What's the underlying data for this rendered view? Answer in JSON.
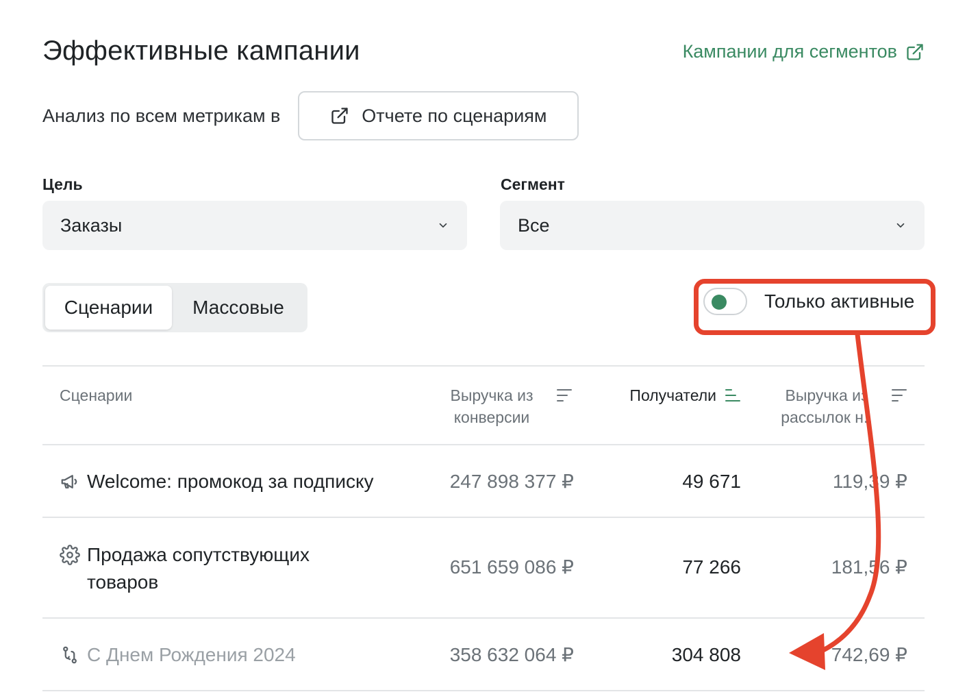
{
  "header": {
    "title": "Эффективные кампании",
    "segments_link": "Кампании для сегментов"
  },
  "analysis": {
    "text": "Анализ по всем метрикам в",
    "report_button": "Отчете по сценариям"
  },
  "filters": {
    "goal_label": "Цель",
    "goal_value": "Заказы",
    "segment_label": "Сегмент",
    "segment_value": "Все"
  },
  "tabs": [
    {
      "label": "Сценарии",
      "active": true
    },
    {
      "label": "Массовые",
      "active": false
    }
  ],
  "toggle": {
    "label": "Только активные",
    "on": true,
    "accent": "#3a8a62"
  },
  "table": {
    "columns": [
      {
        "label": "Сценарии"
      },
      {
        "label": "Выручка из конверсии",
        "sort_icon": "sort-icon"
      },
      {
        "label": "Получатели",
        "sort_icon": "sort-active-icon"
      },
      {
        "label": "Выручка из рассылок н..",
        "sort_icon": "sort-icon"
      }
    ],
    "rows": [
      {
        "icon": "megaphone-icon",
        "name": "Welcome: промокод за подписку",
        "revenue": "247 898 377 ₽",
        "recipients": "49 671",
        "mail_revenue": "119,39 ₽",
        "active": true
      },
      {
        "icon": "gear-icon",
        "name": "Продажа сопутствующих товаров",
        "revenue": "651 659 086 ₽",
        "recipients": "77 266",
        "mail_revenue": "181,56 ₽",
        "active": true
      },
      {
        "icon": "workflow-icon",
        "name": "С Днем Рождения 2024",
        "revenue": "358 632 064 ₽",
        "recipients": "304 808",
        "mail_revenue": "742,69 ₽",
        "active": false
      }
    ]
  },
  "annotation": {
    "color": "#e5432d"
  }
}
